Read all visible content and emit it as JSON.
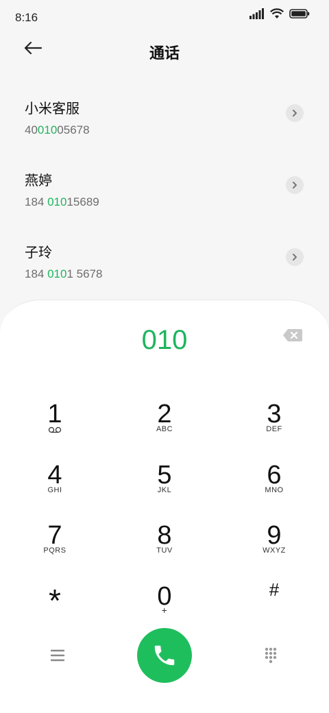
{
  "status_bar": {
    "time": "8:16",
    "icons": [
      "signal-icon",
      "wifi-icon",
      "battery-icon"
    ]
  },
  "header": {
    "title": "通话",
    "back_icon": "arrow-left-icon"
  },
  "contacts": [
    {
      "name": "小米客服",
      "number_parts": {
        "pre": "40",
        "match": "010",
        "post": "05678"
      }
    },
    {
      "name": "燕婷",
      "number_parts": {
        "pre": "184 ",
        "match": "010",
        "post": "15689"
      }
    },
    {
      "name": "子玲",
      "number_parts": {
        "pre": "184 ",
        "match": "010",
        "post": "1 5678"
      }
    }
  ],
  "dialer": {
    "dialed": "010",
    "keys": [
      {
        "digit": "1",
        "letters": "",
        "sub_icon": "voicemail-icon"
      },
      {
        "digit": "2",
        "letters": "ABC"
      },
      {
        "digit": "3",
        "letters": "DEF"
      },
      {
        "digit": "4",
        "letters": "GHI"
      },
      {
        "digit": "5",
        "letters": "JKL"
      },
      {
        "digit": "6",
        "letters": "MNO"
      },
      {
        "digit": "7",
        "letters": "PQRS"
      },
      {
        "digit": "8",
        "letters": "TUV"
      },
      {
        "digit": "9",
        "letters": "WXYZ"
      },
      {
        "digit": "*",
        "letters": ""
      },
      {
        "digit": "0",
        "letters": "+"
      },
      {
        "digit": "#",
        "letters": ""
      }
    ]
  },
  "colors": {
    "accent": "#1fb45e",
    "call_button": "#1fbe5d",
    "number_gray": "#6d6d6d"
  }
}
